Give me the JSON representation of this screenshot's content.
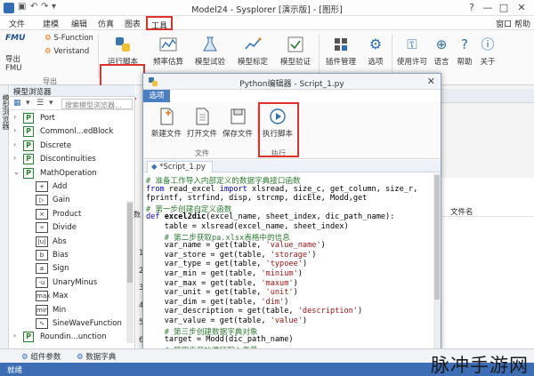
{
  "window": {
    "title": "Model24 - Sysplorer [演示版] - [图形]",
    "qa_icons": [
      "save-icon",
      "undo-icon",
      "redo-icon",
      "dropdown-icon"
    ],
    "controls": [
      "?",
      "—",
      "□",
      "✕"
    ]
  },
  "menubar": {
    "items": [
      "文件",
      "建模",
      "编辑",
      "仿真",
      "图表",
      "工具"
    ],
    "active": "工具",
    "right": "窗口  帮助"
  },
  "ribbon": {
    "fmu_label": "FMU",
    "export_fmu": "导出FMU",
    "s_function": "S-Function",
    "veristand": "Veristand",
    "run_script": "运行脚本",
    "freq_estimate": "频率估算",
    "model_test": "模型试验",
    "model_calibrate": "模型标定",
    "model_verify": "模型验证",
    "plugin_manage": "插件管理",
    "options": "选项",
    "use_license": "使用许可",
    "language": "语言",
    "help": "帮助",
    "about": "关于",
    "group_export": "导出"
  },
  "model_browser": {
    "vertical_tab": "模型浏览器",
    "header": "模型浏览器",
    "search_placeholder": "搜索模型浏览器...",
    "items": [
      {
        "indent": 0,
        "arrow": "›",
        "type": "pkg",
        "label": "Port"
      },
      {
        "indent": 0,
        "arrow": "›",
        "type": "pkg",
        "label": "Commonl...edBlock"
      },
      {
        "indent": 0,
        "arrow": "›",
        "type": "pkg",
        "label": "Discrete"
      },
      {
        "indent": 0,
        "arrow": "›",
        "type": "pkg",
        "label": "Discontinuities"
      },
      {
        "indent": 0,
        "arrow": "⌄",
        "type": "pkg",
        "label": "MathOperation"
      },
      {
        "indent": 1,
        "arrow": "",
        "type": "blk",
        "glyph": "+",
        "label": "Add"
      },
      {
        "indent": 1,
        "arrow": "",
        "type": "blk",
        "glyph": "▷",
        "label": "Gain"
      },
      {
        "indent": 1,
        "arrow": "",
        "type": "blk",
        "glyph": "×",
        "label": "Product"
      },
      {
        "indent": 1,
        "arrow": "",
        "type": "blk",
        "glyph": "÷",
        "label": "Divide"
      },
      {
        "indent": 1,
        "arrow": "",
        "type": "blk",
        "glyph": "|u|",
        "label": "Abs"
      },
      {
        "indent": 1,
        "arrow": "",
        "type": "blk",
        "glyph": "b",
        "label": "Bias"
      },
      {
        "indent": 1,
        "arrow": "",
        "type": "blk",
        "glyph": "±",
        "label": "Sign"
      },
      {
        "indent": 1,
        "arrow": "",
        "type": "blk",
        "glyph": "-u",
        "label": "UnaryMinus"
      },
      {
        "indent": 1,
        "arrow": "",
        "type": "blk",
        "glyph": "max",
        "label": "Max"
      },
      {
        "indent": 1,
        "arrow": "",
        "type": "blk",
        "glyph": "min",
        "label": "Min"
      },
      {
        "indent": 1,
        "arrow": "",
        "type": "blk",
        "glyph": "∿",
        "label": "SineWaveFunction"
      },
      {
        "indent": 0,
        "arrow": "›",
        "type": "pkg",
        "label": "Roundin...unction"
      }
    ]
  },
  "background": {
    "right_header": "文件名",
    "partial_label": "数",
    "row_numbers": [
      "1",
      "2",
      "3",
      "4",
      "5",
      "6"
    ]
  },
  "python_editor": {
    "title": "Python编辑器 - Script_1.py",
    "menu_tab": "选项",
    "new_file": "新建文件",
    "open_file": "打开文件",
    "save_file": "保存文件",
    "run_script": "执行脚本",
    "group_file": "文件",
    "group_run": "执行",
    "tab_name": "*Script_1.py",
    "tab_close": "×",
    "code_lines": [
      [
        {
          "c": "c-cmt",
          "t": "# 准备工作导入内部定义的数据字典接口函数"
        }
      ],
      [
        {
          "c": "c-kw",
          "t": "from"
        },
        {
          "c": "",
          "t": " read_excel "
        },
        {
          "c": "c-kw",
          "t": "import"
        },
        {
          "c": "",
          "t": " xlsread, size_c, get_column, size_r,"
        }
      ],
      [
        {
          "c": "",
          "t": "fprintf, strfind, disp, strcmp, dicEle, Modd,get"
        }
      ],
      [
        {
          "c": "c-cmt",
          "t": "# 第一步创建自定义函数"
        }
      ],
      [
        {
          "c": "c-kw",
          "t": "def"
        },
        {
          "c": "c-fn",
          "t": " excel2dic"
        },
        {
          "c": "",
          "t": "(excel_name, sheet_index, dic_path_name):"
        }
      ],
      [
        {
          "c": "",
          "t": "    table = xlsread(excel_name, sheet_index)"
        }
      ],
      [
        {
          "c": "c-cmt",
          "t": "    # 第二步获取pa.xlsx表格中的信息"
        }
      ],
      [
        {
          "c": "",
          "t": "    var_name = get(table, "
        },
        {
          "c": "c-str",
          "t": "'value_name'"
        },
        {
          "c": "",
          "t": ")"
        }
      ],
      [
        {
          "c": "",
          "t": "    var_store = get(table, "
        },
        {
          "c": "c-str",
          "t": "'storage'"
        },
        {
          "c": "",
          "t": ")"
        }
      ],
      [
        {
          "c": "",
          "t": "    var_type = get(table, "
        },
        {
          "c": "c-str",
          "t": "'typoee'"
        },
        {
          "c": "",
          "t": ")"
        }
      ],
      [
        {
          "c": "",
          "t": "    var_min = get(table, "
        },
        {
          "c": "c-str",
          "t": "'minium'"
        },
        {
          "c": "",
          "t": ")"
        }
      ],
      [
        {
          "c": "",
          "t": "    var_max = get(table, "
        },
        {
          "c": "c-str",
          "t": "'maxum'"
        },
        {
          "c": "",
          "t": ")"
        }
      ],
      [
        {
          "c": "",
          "t": "    var_unit = get(table, "
        },
        {
          "c": "c-str",
          "t": "'unit'"
        },
        {
          "c": "",
          "t": ")"
        }
      ],
      [
        {
          "c": "",
          "t": "    var_dim = get(table, "
        },
        {
          "c": "c-str",
          "t": "'dim'"
        },
        {
          "c": "",
          "t": ")"
        }
      ],
      [
        {
          "c": "",
          "t": "    var_description = get(table, "
        },
        {
          "c": "c-str",
          "t": "'description'"
        },
        {
          "c": "",
          "t": ")"
        }
      ],
      [
        {
          "c": "",
          "t": "    var_value = get(table, "
        },
        {
          "c": "c-str",
          "t": "'value'"
        },
        {
          "c": "",
          "t": ")"
        }
      ],
      [
        {
          "c": "c-cmt",
          "t": "    # 第三步创建数据字典对象"
        }
      ],
      [
        {
          "c": "",
          "t": "    target = Modd(dic_path_name)"
        }
      ],
      [
        {
          "c": "c-cmt",
          "t": "    # 第四步开始循环写入变量"
        }
      ]
    ]
  },
  "bottombar": {
    "tab1": "组件参数",
    "tab2": "数据字典"
  },
  "statusbar": {
    "text": "就绪"
  },
  "watermark": "脉冲手游网",
  "colors": {
    "highlight_red": "#e0322b",
    "accent_blue": "#3c6db5",
    "comment_green": "#2e7d32",
    "keyword_blue": "#0000c8",
    "string_red": "#a31515"
  }
}
